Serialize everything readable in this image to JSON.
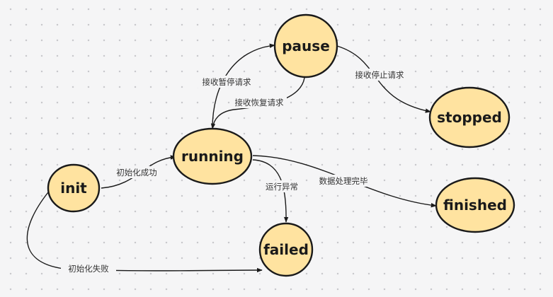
{
  "nodes": {
    "pause": "pause",
    "stopped": "stopped",
    "running": "running",
    "init": "init",
    "finished": "finished",
    "failed": "failed"
  },
  "edges": {
    "receive_pause": "接收暂停请求",
    "receive_resume": "接收恢复请求",
    "receive_stop": "接收停止请求",
    "init_success": "初始化成功",
    "run_error": "运行异常",
    "data_done": "数据处理完毕",
    "init_fail": "初始化失败"
  },
  "colors": {
    "node_fill": "#ffe3a0",
    "node_stroke": "#1a1a1a",
    "background": "#f5f5f6"
  }
}
